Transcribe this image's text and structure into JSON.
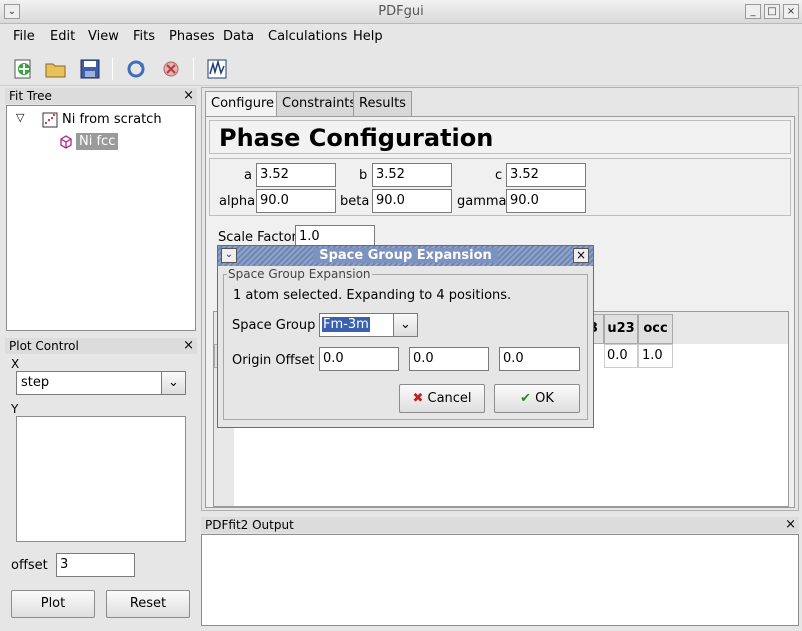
{
  "window": {
    "title": "PDFgui"
  },
  "menubar": {
    "items": [
      "File",
      "Edit",
      "View",
      "Fits",
      "Phases",
      "Data",
      "Calculations",
      "Help"
    ]
  },
  "fit_tree": {
    "title": "Fit Tree",
    "fit": "Ni from scratch",
    "phase": "Ni fcc"
  },
  "plot_control": {
    "title": "Plot Control",
    "x_label": "X",
    "x_value": "step",
    "y_label": "Y",
    "offset_label": "offset",
    "offset_value": "3",
    "plot_button": "Plot",
    "reset_button": "Reset"
  },
  "tabs": [
    "Configure",
    "Constraints",
    "Results"
  ],
  "phase_config": {
    "heading": "Phase Configuration",
    "a_label": "a",
    "a": "3.52",
    "b_label": "b",
    "b": "3.52",
    "c_label": "c",
    "c": "3.52",
    "alpha_label": "alpha",
    "alpha": "90.0",
    "beta_label": "beta",
    "beta": "90.0",
    "gamma_label": "gamma",
    "gamma": "90.0",
    "scale_label": "Scale Factor",
    "scale": "1.0"
  },
  "atom_table": {
    "headers": [
      "3",
      "u23",
      "occ"
    ],
    "row": [
      "0.0",
      "1.0"
    ]
  },
  "output_panel": {
    "title": "PDFfit2 Output"
  },
  "dialog": {
    "title": "Space Group Expansion",
    "group_label": "Space Group Expansion",
    "message": "1 atom selected.  Expanding to 4 positions.",
    "space_group_label": "Space Group",
    "space_group_value": "Fm-3m",
    "origin_label": "Origin Offset",
    "origin": [
      "0.0",
      "0.0",
      "0.0"
    ],
    "cancel": "Cancel",
    "ok": "OK"
  }
}
